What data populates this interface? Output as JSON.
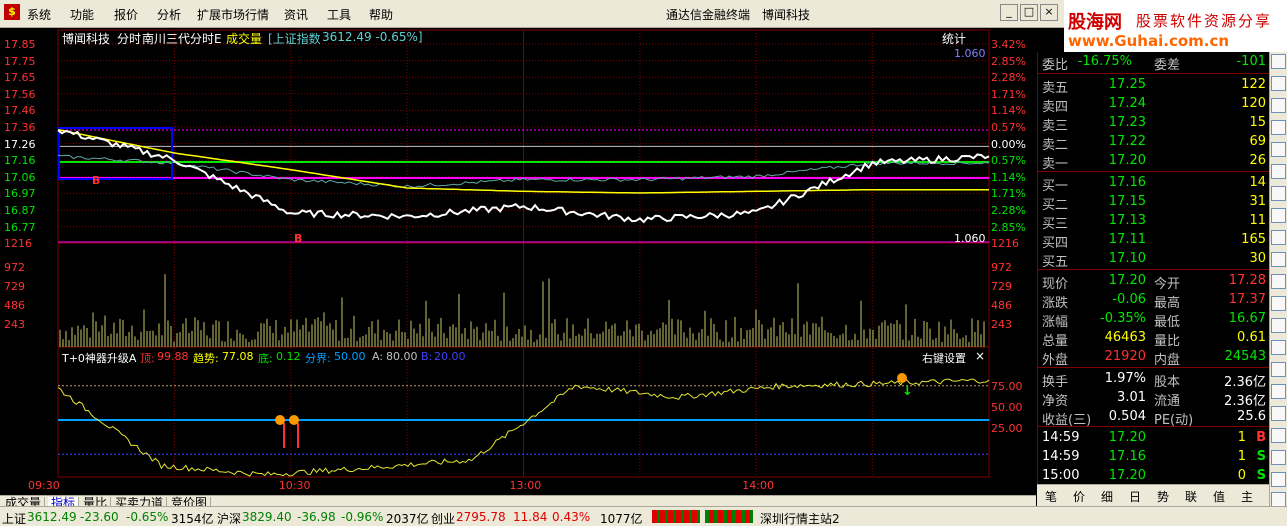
{
  "menu": {
    "logo": "$",
    "items": [
      "系统",
      "功能",
      "报价",
      "分析",
      "扩展市场行情",
      "资讯",
      "工具",
      "帮助"
    ],
    "title": "通达信金融终端　博闻科技",
    "window_controls": [
      "_",
      "□",
      "×"
    ]
  },
  "banner": {
    "main": "股海网",
    "sub": "股票软件资源分享",
    "url": "www.Guhai.com.cn"
  },
  "chart_header": {
    "stock": "博闻科技",
    "mode": "分时",
    "indicator_name": "南川三代分时E",
    "volume_label": "成交量",
    "index_label": "[上证指数",
    "index_value": "3612.49 -0.65%]",
    "stats_button": "统计",
    "ratio_top": "1.060",
    "ratio_low": "1.060"
  },
  "price_axis": [
    "17.85",
    "17.75",
    "17.65",
    "17.56",
    "17.46",
    "17.36",
    "17.26",
    "17.16",
    "17.06",
    "16.97",
    "16.87",
    "16.77",
    "1216"
  ],
  "pct_axis": [
    "3.42%",
    "2.85%",
    "2.28%",
    "1.71%",
    "1.14%",
    "0.57%",
    "0.00%",
    "0.57%",
    "1.14%",
    "1.71%",
    "2.28%",
    "2.85%",
    "1216"
  ],
  "volume_axis": [
    "972",
    "729",
    "486",
    "243"
  ],
  "indicator_header": {
    "name": "T+0神器升级A",
    "top_label": "顶:",
    "top_value": "99.88",
    "trend_label": "趋势:",
    "trend_value": "77.08",
    "bottom_label": "底:",
    "bottom_value": "0.12",
    "bound_label": "分界:",
    "bound_value": "50.00",
    "a_label": "A:",
    "a_value": "80.00",
    "b_label": "B:",
    "b_value": "20.00",
    "settings": "右键设置",
    "close": "×"
  },
  "indicator_axis": [
    "75.00",
    "50.00",
    "25.00"
  ],
  "time_axis": [
    "09:30",
    "10:30",
    "13:00",
    "14:00"
  ],
  "markers": {
    "buy": "B",
    "sell_arrow": "↓"
  },
  "chart_data": {
    "type": "line",
    "x": [
      "09:30",
      "10:00",
      "10:30",
      "11:00",
      "11:30/13:00",
      "13:30",
      "14:00",
      "14:30",
      "15:00"
    ],
    "xlim": [
      "09:30",
      "15:00"
    ],
    "price_ylim": [
      16.68,
      17.85
    ],
    "base_price": 17.26,
    "series": [
      {
        "name": "price",
        "values": [
          17.36,
          17.18,
          16.86,
          16.84,
          16.9,
          16.82,
          16.86,
          17.16,
          17.2
        ]
      },
      {
        "name": "avg",
        "values": [
          17.36,
          17.22,
          17.12,
          17.01,
          16.99,
          16.98,
          16.99,
          17.0,
          17.0
        ]
      }
    ],
    "volume_ylim": [
      0,
      1216
    ],
    "indicator_ylim": [
      0,
      100
    ],
    "indicator_levels": [
      80.0,
      50.0,
      20.0
    ],
    "indicator_series": [
      {
        "name": "T+0",
        "values": [
          78,
          10,
          2,
          8,
          15,
          80,
          70,
          80,
          82,
          85
        ]
      }
    ]
  },
  "quote": {
    "webi_label": "委比",
    "webi_value": "-16.75%",
    "wecha_label": "委差",
    "wecha_value": "-101",
    "asks": [
      {
        "label": "卖五",
        "price": "17.25",
        "vol": "122"
      },
      {
        "label": "卖四",
        "price": "17.24",
        "vol": "120"
      },
      {
        "label": "卖三",
        "price": "17.23",
        "vol": "15"
      },
      {
        "label": "卖二",
        "price": "17.22",
        "vol": "69"
      },
      {
        "label": "卖一",
        "price": "17.20",
        "vol": "26"
      }
    ],
    "bids": [
      {
        "label": "买一",
        "price": "17.16",
        "vol": "14"
      },
      {
        "label": "买二",
        "price": "17.15",
        "vol": "31"
      },
      {
        "label": "买三",
        "price": "17.13",
        "vol": "11"
      },
      {
        "label": "买四",
        "price": "17.11",
        "vol": "165"
      },
      {
        "label": "买五",
        "price": "17.10",
        "vol": "30"
      }
    ],
    "stats": [
      {
        "l1": "现价",
        "v1": "17.20",
        "l2": "今开",
        "v2": "17.28"
      },
      {
        "l1": "涨跌",
        "v1": "-0.06",
        "l2": "最高",
        "v2": "17.37"
      },
      {
        "l1": "涨幅",
        "v1": "-0.35%",
        "l2": "最低",
        "v2": "16.67"
      },
      {
        "l1": "总量",
        "v1": "46463",
        "l2": "量比",
        "v2": "0.61"
      },
      {
        "l1": "外盘",
        "v1": "21920",
        "l2": "内盘",
        "v2": "24543"
      }
    ],
    "stats2": [
      {
        "l1": "换手",
        "v1": "1.97%",
        "l2": "股本",
        "v2": "2.36亿"
      },
      {
        "l1": "净资",
        "v1": "3.01",
        "l2": "流通",
        "v2": "2.36亿"
      },
      {
        "l1": "收益(三)",
        "v1": "0.504",
        "l2": "PE(动)",
        "v2": "25.6"
      }
    ],
    "ticks": [
      {
        "time": "14:59",
        "price": "17.20",
        "vol": "1",
        "flag": "B"
      },
      {
        "time": "14:59",
        "price": "17.16",
        "vol": "1",
        "flag": "S"
      },
      {
        "time": "15:00",
        "price": "17.20",
        "vol": "0",
        "flag": "S"
      }
    ]
  },
  "right_tabs": [
    "笔",
    "价",
    "细",
    "日",
    "势",
    "联",
    "值",
    "主"
  ],
  "bottom_tabs_1": [
    "成交量",
    "指标",
    "量比",
    "买卖力道",
    "竞价图"
  ],
  "bottom_tabs_2": [
    "开弹幕",
    "扩展八",
    "关联报价"
  ],
  "status": {
    "sh_label": "上证",
    "sh_value": "3612.49",
    "sh_change": "-23.60",
    "sh_pct": "-0.65%",
    "sh_amount": "3154亿",
    "sz_label": "沪深",
    "sz_value": "3829.40",
    "sz_change": "-36.98",
    "sz_pct": "-0.96%",
    "sz_amount": "2037亿",
    "cy_label": "创业",
    "cy_value": "2795.78",
    "cy_change": "11.84",
    "cy_pct": "0.43%",
    "cy_amount": "1077亿",
    "server": "深圳行情主站2"
  },
  "colors": {
    "price": "#ffffff",
    "avg": "#ffff00",
    "index": "#5fa8a8",
    "grid": "#800000",
    "up": "#ff3232",
    "down": "#00e600",
    "box": "#0000ff",
    "magenta": "#ff00ff",
    "level_line": "#00a0ff"
  }
}
